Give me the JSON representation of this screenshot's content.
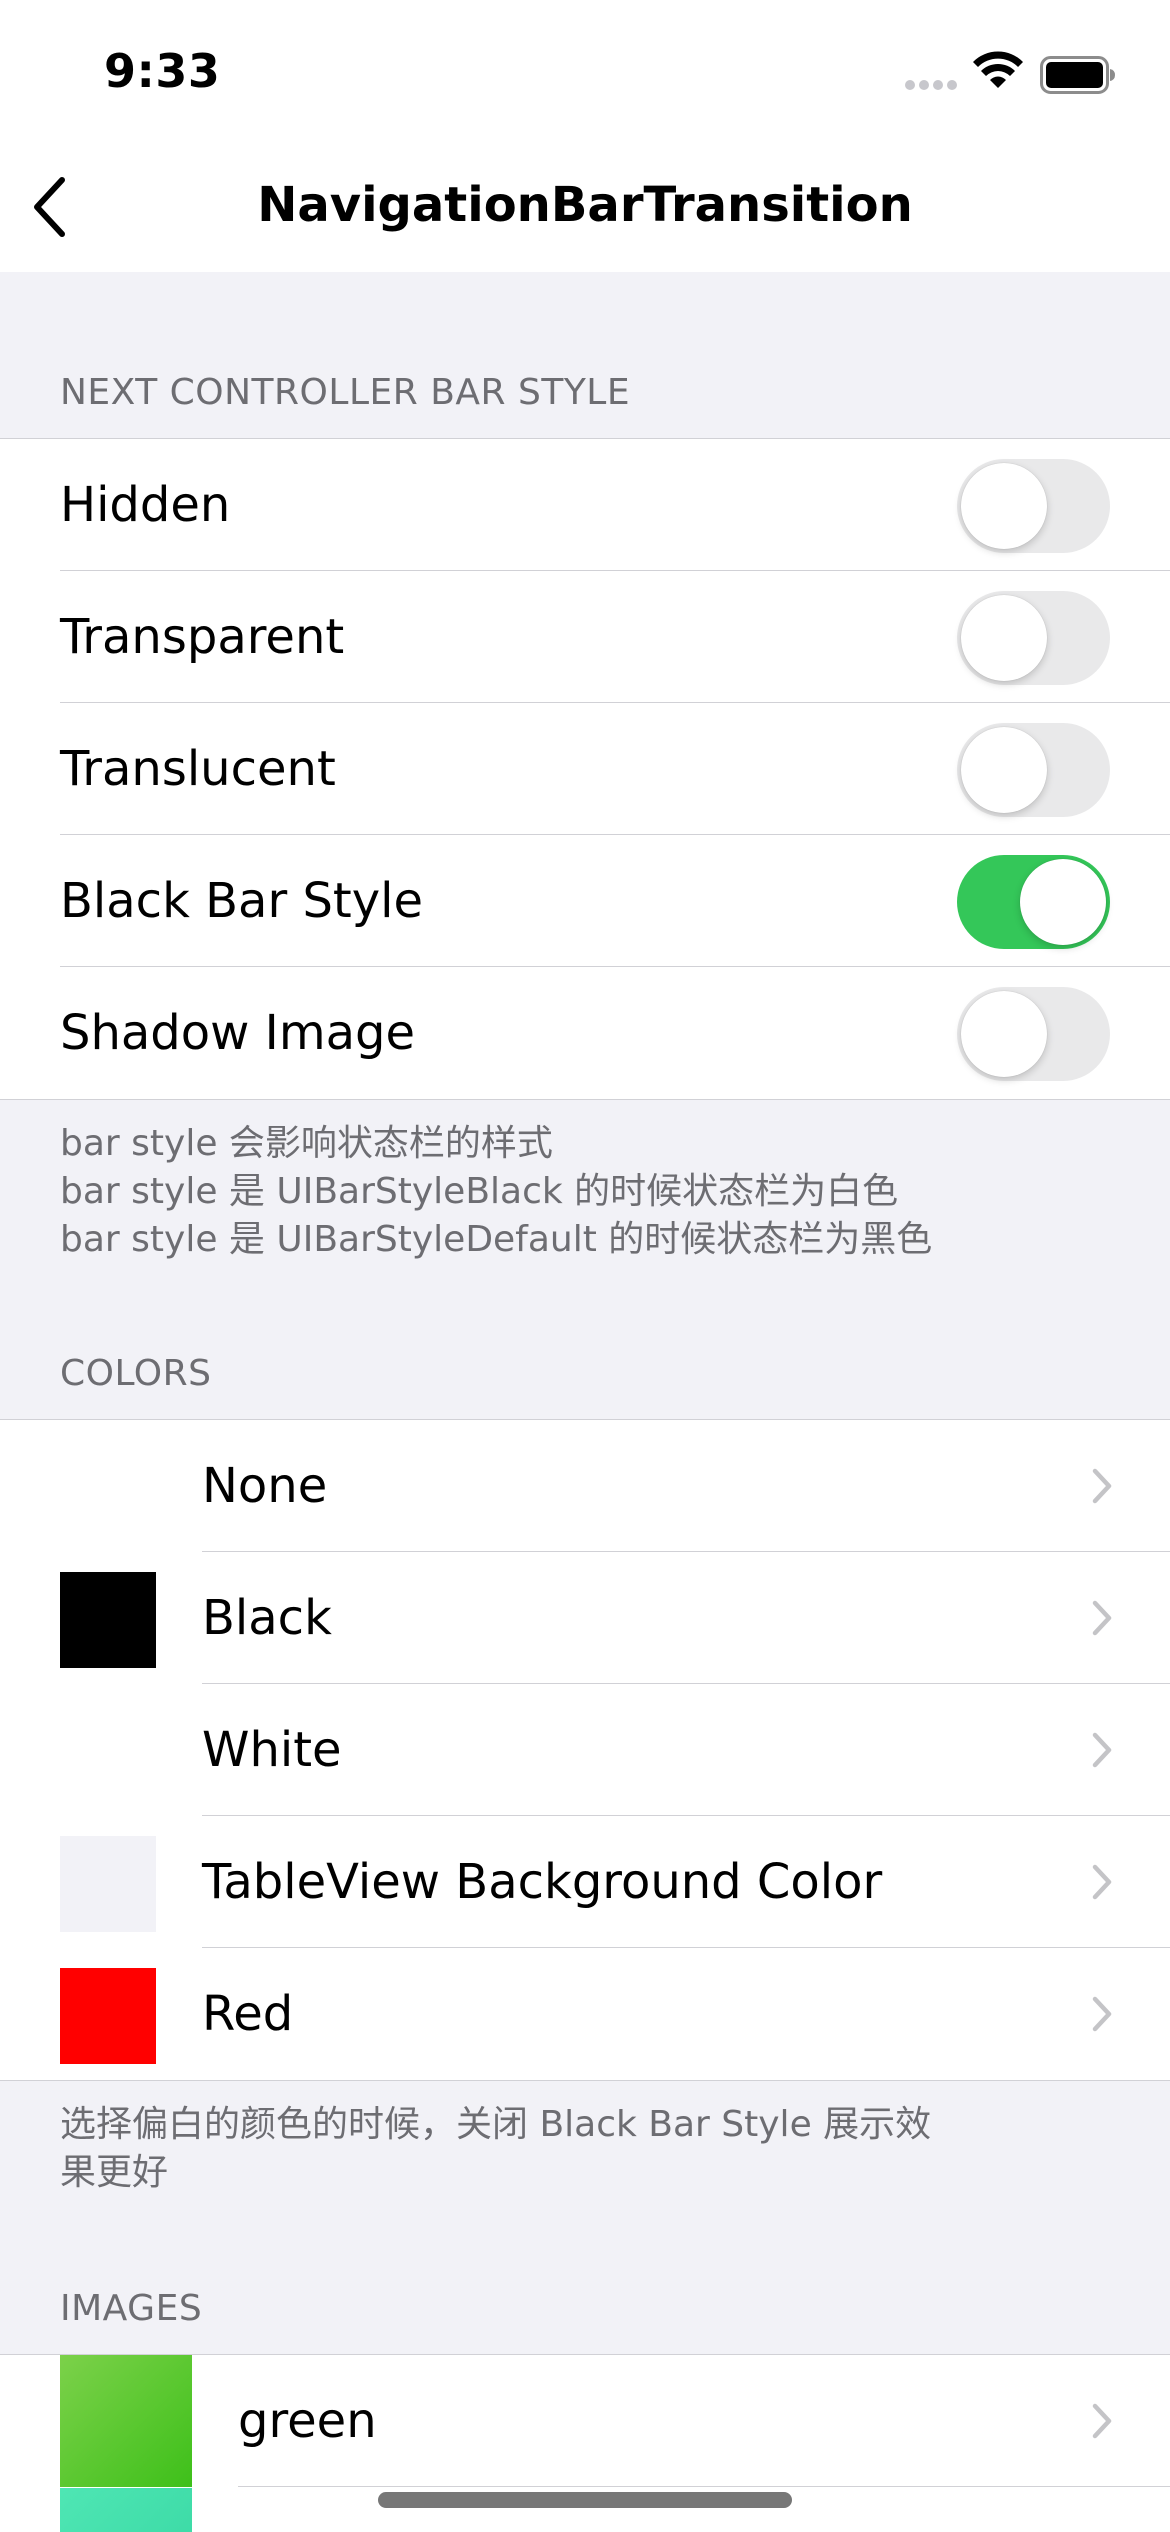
{
  "status_bar": {
    "time": "9:33"
  },
  "nav": {
    "title": "NavigationBarTransition"
  },
  "sections": {
    "bar_style": {
      "header": "NEXT CONTROLLER BAR STYLE",
      "rows": [
        {
          "label": "Hidden",
          "on": false
        },
        {
          "label": "Transparent",
          "on": false
        },
        {
          "label": "Translucent",
          "on": false
        },
        {
          "label": "Black Bar Style",
          "on": true
        },
        {
          "label": "Shadow Image",
          "on": false
        }
      ],
      "footer_lines": [
        "bar style 会影响状态栏的样式",
        "bar style 是 UIBarStyleBlack 的时候状态栏为白色",
        "bar style 是 UIBarStyleDefault 的时候状态栏为黑色"
      ]
    },
    "colors": {
      "header": "COLORS",
      "rows": [
        {
          "label": "None",
          "swatch": null
        },
        {
          "label": "Black",
          "swatch": "#000000"
        },
        {
          "label": "White",
          "swatch": "#ffffff"
        },
        {
          "label": "TableView Background Color",
          "swatch": "#f2f2f7"
        },
        {
          "label": "Red",
          "swatch": "#ff0000"
        }
      ],
      "footer_lines": [
        "选择偏白的颜色的时候，关闭 Black Bar Style 展示效",
        "果更好"
      ]
    },
    "images": {
      "header": "IMAGES",
      "rows": [
        {
          "label": "green"
        }
      ]
    }
  },
  "colors": {
    "toggle_on": "#34c759",
    "toggle_off": "#e9e9ea",
    "background": "#f2f2f7"
  }
}
